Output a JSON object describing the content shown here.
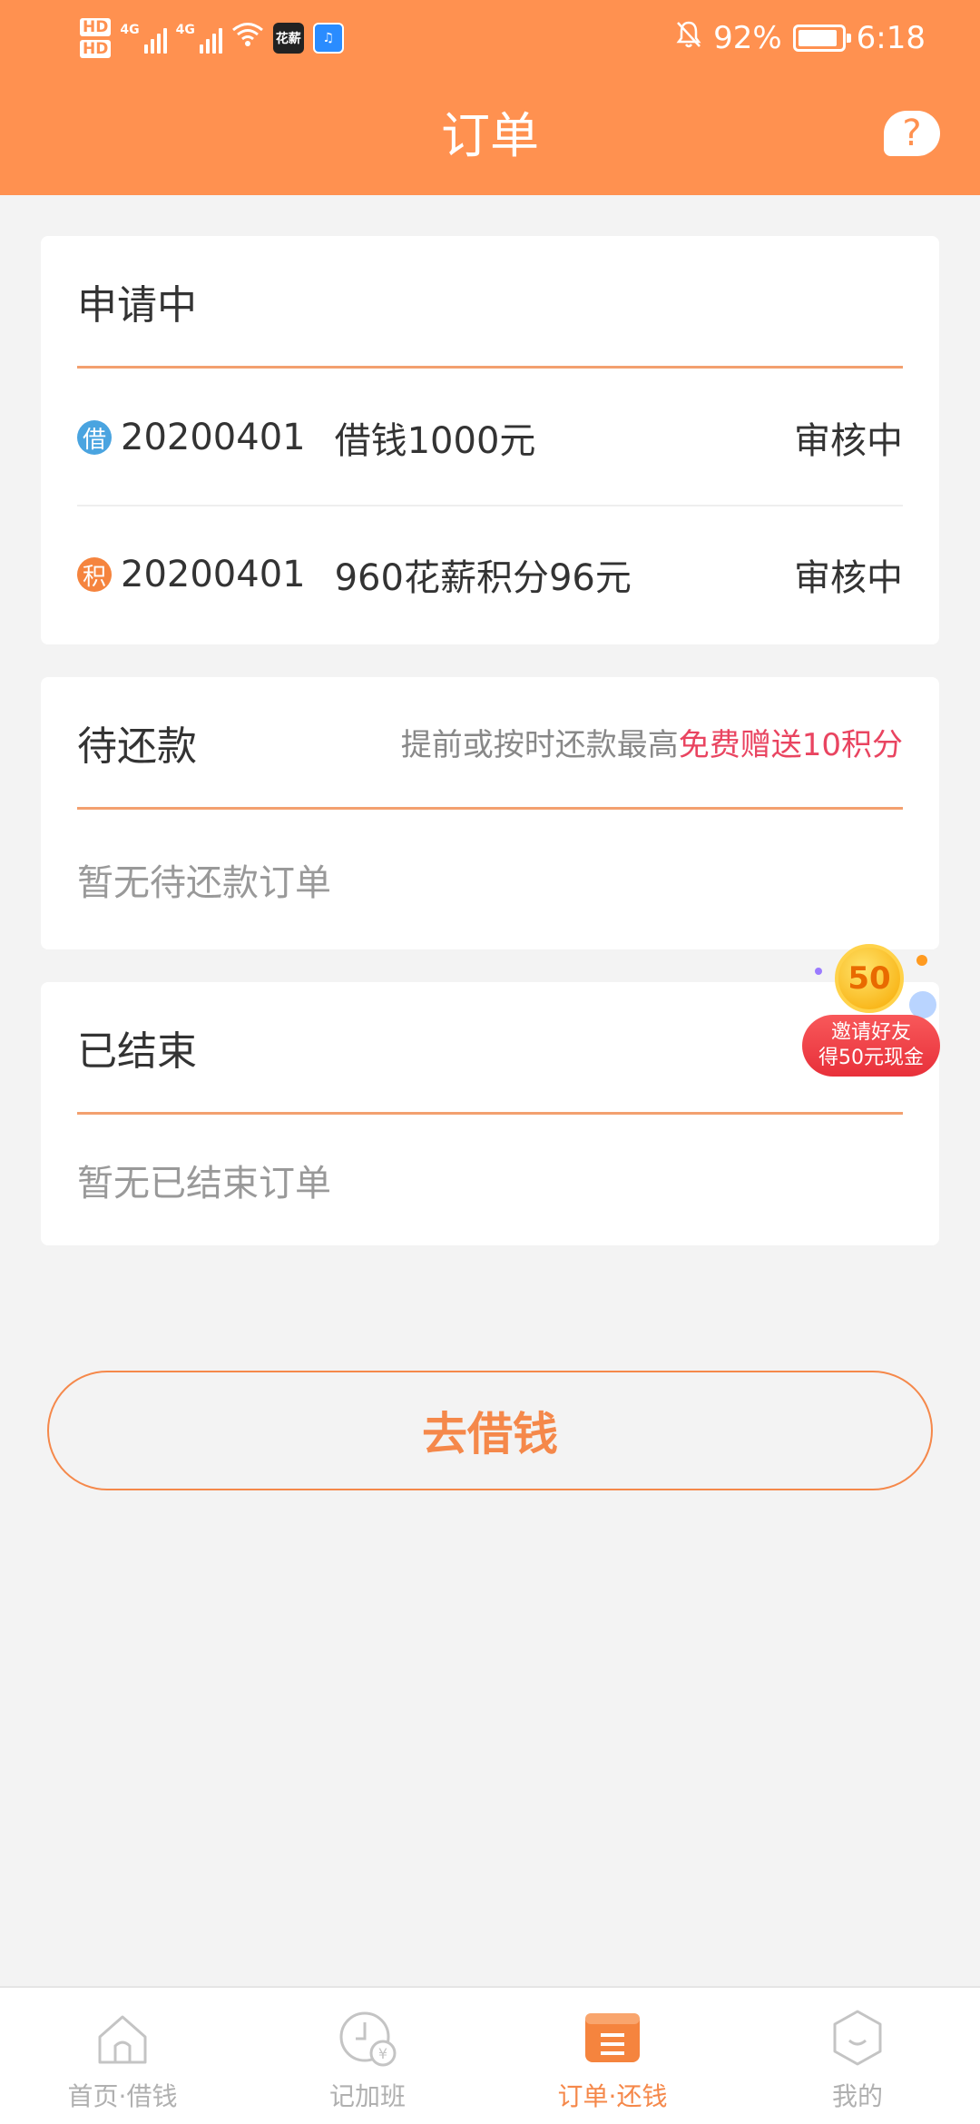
{
  "status_bar": {
    "hd_labels": [
      "HD",
      "HD"
    ],
    "net1": "4G",
    "net2": "4G",
    "app_icon_1": "花薪",
    "battery_percent": "92%",
    "battery_level": 0.92,
    "time": "6:18"
  },
  "header": {
    "title": "订单",
    "help_label": "?"
  },
  "sections": {
    "applying": {
      "title": "申请中",
      "orders": [
        {
          "badge": "借",
          "number": "20200401",
          "description": "借钱1000元",
          "status": "审核中"
        },
        {
          "badge": "积",
          "number": "20200401",
          "description": "960花薪积分96元",
          "status": "审核中"
        }
      ]
    },
    "pending": {
      "title": "待还款",
      "tip_prefix": "提前或按时还款最高",
      "tip_highlight": "免费赠送10积分",
      "empty_text": "暂无待还款订单"
    },
    "finished": {
      "title": "已结束",
      "empty_text": "暂无已结束订单"
    }
  },
  "invite": {
    "coin_value": "50",
    "line1": "邀请好友",
    "line2": "得50元现金"
  },
  "cta": {
    "label": "去借钱"
  },
  "nav": {
    "items": [
      {
        "label": "首页·借钱",
        "icon": "home-icon",
        "active": false
      },
      {
        "label": "记加班",
        "icon": "clock-yen-icon",
        "active": false
      },
      {
        "label": "订单·还钱",
        "icon": "orders-icon",
        "active": true
      },
      {
        "label": "我的",
        "icon": "profile-icon",
        "active": false
      }
    ]
  },
  "colors": {
    "brand": "#ff9150",
    "accent": "#f5884a",
    "highlight": "#e94460",
    "badge_blue": "#4aa4e0",
    "badge_orange": "#f5843e"
  }
}
